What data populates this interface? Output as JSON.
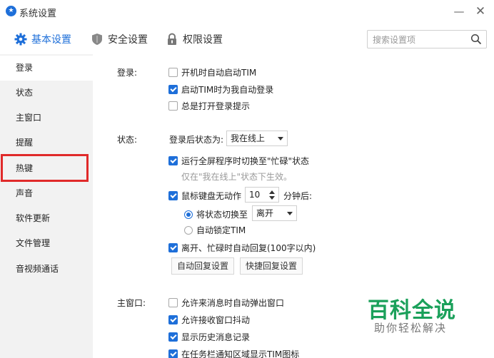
{
  "window": {
    "title": "系统设置",
    "minimize_glyph": "—",
    "close_glyph": "✕"
  },
  "tabs": [
    {
      "label": "基本设置",
      "icon": "gear-icon",
      "active": true
    },
    {
      "label": "安全设置",
      "icon": "shield-icon",
      "active": false
    },
    {
      "label": "权限设置",
      "icon": "lock-icon",
      "active": false
    }
  ],
  "search": {
    "placeholder": "搜索设置项",
    "value": ""
  },
  "sidebar": {
    "items": [
      {
        "label": "登录",
        "active": true
      },
      {
        "label": "状态"
      },
      {
        "label": "主窗口"
      },
      {
        "label": "提醒"
      },
      {
        "label": "热键",
        "highlighted": true
      },
      {
        "label": "声音"
      },
      {
        "label": "软件更新"
      },
      {
        "label": "文件管理"
      },
      {
        "label": "音视频通话"
      }
    ]
  },
  "login": {
    "label": "登录:",
    "auto_start": {
      "label": "开机时自动启动TIM",
      "checked": false
    },
    "auto_login": {
      "label": "启动TIM时为我自动登录",
      "checked": true
    },
    "show_prompt": {
      "label": "总是打开登录提示",
      "checked": false
    }
  },
  "status": {
    "label": "状态:",
    "after_login_label": "登录后状态为:",
    "after_login_value": "我在线上",
    "fullscreen_busy": {
      "label": "运行全屏程序时切换至\"忙碌\"状态",
      "checked": true
    },
    "fullscreen_hint": "仅在\"我在线上\"状态下生效。",
    "idle": {
      "label": "鼠标键盘无动作",
      "checked": true,
      "minutes": "10",
      "suffix": "分钟后:"
    },
    "switch_to": {
      "label": "将状态切换至",
      "checked": true,
      "value": "离开"
    },
    "auto_lock": {
      "label": "自动锁定TIM",
      "checked": false
    },
    "auto_reply": {
      "label": "离开、忙碌时自动回复(100字以内)",
      "checked": true
    },
    "auto_reply_btn": "自动回复设置",
    "quick_reply_btn": "快捷回复设置"
  },
  "main_window": {
    "label": "主窗口:",
    "popup": {
      "label": "允许来消息时自动弹出窗口",
      "checked": false
    },
    "shake": {
      "label": "允许接收窗口抖动",
      "checked": true
    },
    "history": {
      "label": "显示历史消息记录",
      "checked": true
    },
    "tray_icon": {
      "label": "在任务栏通知区域显示TIM图标",
      "checked": true
    }
  },
  "watermark": {
    "title": "百科全说",
    "subtitle": "助你轻松解决"
  },
  "colors": {
    "accent": "#1e6fd9",
    "highlight": "#e02a2a",
    "watermark": "#1aa05a"
  }
}
